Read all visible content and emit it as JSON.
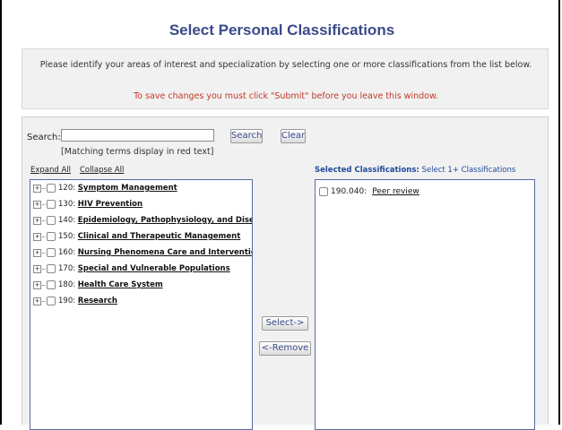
{
  "title": "Select Personal Classifications",
  "instructions": "Please identify your areas of interest and specialization by selecting one or more classifications from the list below.",
  "warning": "To save changes you must click \"Submit\" before you leave this window.",
  "search": {
    "label": "Search:",
    "value": "",
    "search_button": "Search",
    "clear_button": "Clear",
    "hint": "[Matching terms display in red text]"
  },
  "tree_controls": {
    "expand_all": "Expand All",
    "collapse_all": "Collapse All"
  },
  "tree_items": [
    {
      "code": "120:",
      "name": "Symptom Management"
    },
    {
      "code": "130:",
      "name": "HIV Prevention"
    },
    {
      "code": "140:",
      "name": "Epidemiology, Pathophysiology, and Disease Pr"
    },
    {
      "code": "150:",
      "name": "Clinical and Therapeutic Management"
    },
    {
      "code": "160:",
      "name": "Nursing Phenomena Care and Interventions"
    },
    {
      "code": "170:",
      "name": "Special and Vulnerable Populations"
    },
    {
      "code": "180:",
      "name": "Health Care System"
    },
    {
      "code": "190:",
      "name": "Research"
    }
  ],
  "selected": {
    "heading_bold": "Selected Classifications:",
    "heading_hint": "Select 1+ Classifications",
    "items": [
      {
        "code": "190.040:",
        "name": "Peer review"
      }
    ]
  },
  "transfer": {
    "select_button": "Select->",
    "remove_button": "<-Remove"
  },
  "colors": {
    "title": "#3a4a8a",
    "warning": "#c0392b",
    "panel_bg": "#f1f1f1",
    "heading": "#1f4a9a"
  }
}
